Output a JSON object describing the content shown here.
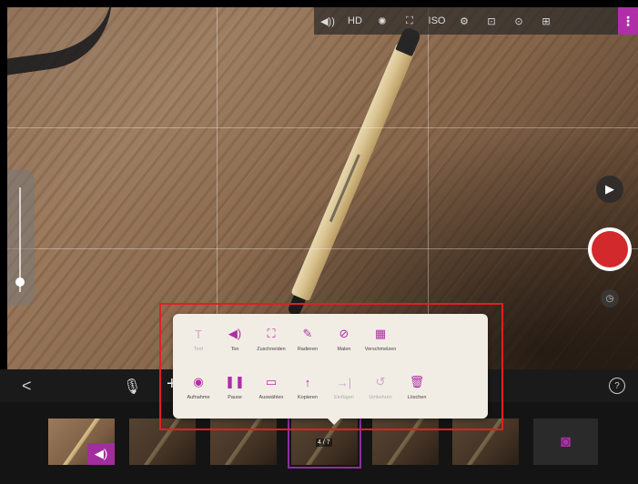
{
  "top_toolbar": {
    "icons": [
      "sound-icon",
      "hd-icon",
      "exposure-icon",
      "focus-icon",
      "iso-icon",
      "settings-icon",
      "flip-camera-icon",
      "camera-switch-icon",
      "grid-icon",
      "more-menu-icon"
    ],
    "labels": [
      "◀))",
      "HD",
      "✺",
      "⛶",
      "ISO",
      "⚙",
      "⊡",
      "⊙",
      "⊞",
      "⋮"
    ]
  },
  "zoom": {
    "level": 0.1
  },
  "side": {
    "play_label": "▶",
    "speed_label": "◷"
  },
  "controls": {
    "back_label": "<",
    "mic_label": "🎙",
    "add_label": "+",
    "help_label": "?"
  },
  "timeline": {
    "current_counter": "4 / 7",
    "camera_label": "◙",
    "sound_label": "◀)"
  },
  "popup": {
    "row1": [
      {
        "icon": "text-icon",
        "glyph": "T",
        "label": "Text",
        "enabled": false
      },
      {
        "icon": "sound-icon",
        "glyph": "◀)",
        "label": "Ton",
        "enabled": true
      },
      {
        "icon": "crop-icon",
        "glyph": "⛶",
        "label": "Zuschneiden",
        "enabled": true
      },
      {
        "icon": "eraser-icon",
        "glyph": "✎",
        "label": "Radieren",
        "enabled": true
      },
      {
        "icon": "paint-icon",
        "glyph": "⊘",
        "label": "Malen",
        "enabled": true
      },
      {
        "icon": "blur-icon",
        "glyph": "▦",
        "label": "Verschmelzen",
        "enabled": true
      }
    ],
    "row2": [
      {
        "icon": "record-icon",
        "glyph": "◉",
        "label": "Aufnahme",
        "enabled": true
      },
      {
        "icon": "pause-icon",
        "glyph": "❚❚",
        "label": "Pause",
        "enabled": true
      },
      {
        "icon": "select-icon",
        "glyph": "▭",
        "label": "Auswählen",
        "enabled": true
      },
      {
        "icon": "copy-icon",
        "glyph": "↑",
        "label": "Kopieren",
        "enabled": true
      },
      {
        "icon": "paste-icon",
        "glyph": "→|",
        "label": "Einfügen",
        "enabled": false
      },
      {
        "icon": "undo-icon",
        "glyph": "↺",
        "label": "Umkehren",
        "enabled": false
      },
      {
        "icon": "delete-icon",
        "glyph": "🗑",
        "label": "Löschen",
        "enabled": true
      }
    ]
  }
}
